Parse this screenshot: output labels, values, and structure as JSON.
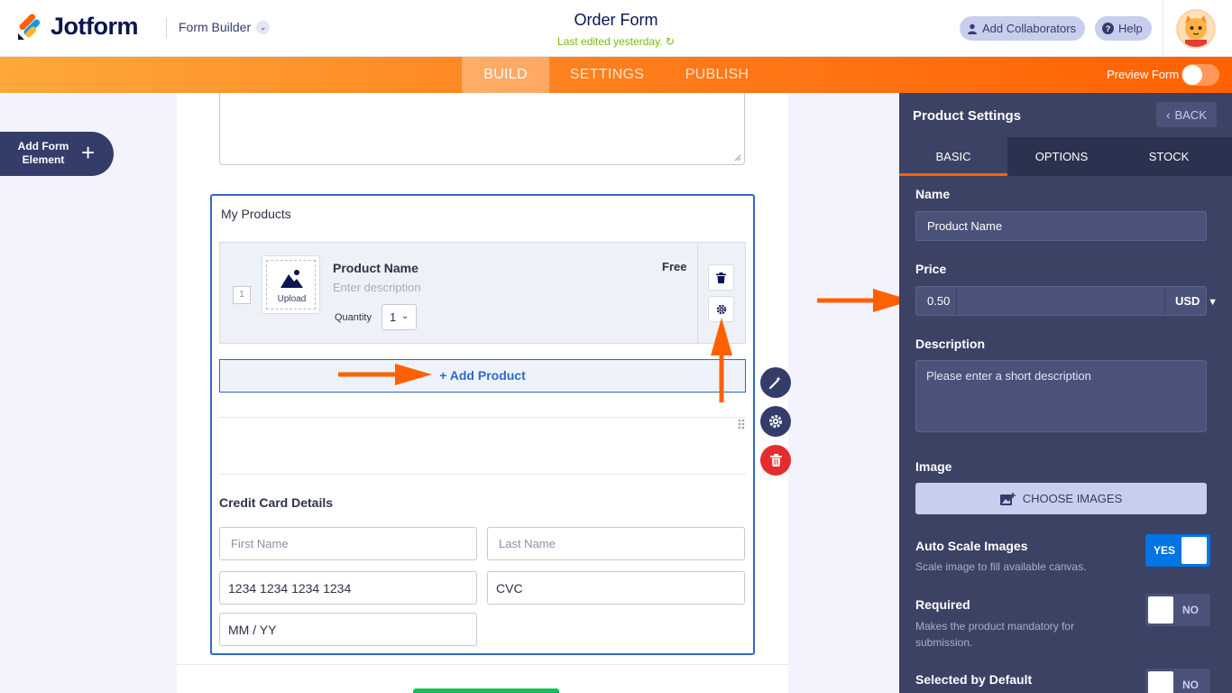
{
  "header": {
    "brand": "Jotform",
    "builder_label": "Form Builder",
    "form_title": "Order Form",
    "last_edited": "Last edited yesterday.",
    "collab_label": "Add Collaborators",
    "help_label": "Help"
  },
  "nav": {
    "tabs": [
      {
        "label": "BUILD"
      },
      {
        "label": "SETTINGS"
      },
      {
        "label": "PUBLISH"
      }
    ],
    "preview_label": "Preview Form"
  },
  "sidebar": {
    "add_element_label": "Add Form Element"
  },
  "form": {
    "products_label": "My Products",
    "product": {
      "number": "1",
      "upload_label": "Upload",
      "name": "Product Name",
      "description_placeholder": "Enter description",
      "quantity_label": "Quantity",
      "quantity_value": "1",
      "price_label": "Free"
    },
    "add_product_label": "+ Add Product",
    "cc_title": "Credit Card Details",
    "cc_fields": {
      "first_name": "First Name",
      "last_name": "Last Name",
      "card_number": "1234 1234 1234 1234",
      "cvc": "CVC",
      "expiry": "MM / YY"
    }
  },
  "panel": {
    "title": "Product Settings",
    "back_label": "BACK",
    "tabs": [
      {
        "label": "BASIC"
      },
      {
        "label": "OPTIONS"
      },
      {
        "label": "STOCK"
      }
    ],
    "name_label": "Name",
    "name_value": "Product Name",
    "price_label": "Price",
    "price_value": "0.50",
    "currency": "USD",
    "description_label": "Description",
    "description_placeholder": "Please enter a short description",
    "image_label": "Image",
    "choose_images_label": "CHOOSE IMAGES",
    "auto_scale": {
      "label": "Auto Scale Images",
      "sub": "Scale image to fill available canvas.",
      "state": "YES"
    },
    "required": {
      "label": "Required",
      "sub": "Makes the product mandatory for submission.",
      "state": "NO"
    },
    "selected_default": {
      "label": "Selected by Default",
      "state": "NO"
    }
  },
  "colors": {
    "accent_orange": "#ff6100",
    "brand_navy": "#0a1551",
    "link_blue": "#2e69c9",
    "panel_bg": "#3b4264",
    "success_green": "#78bb07",
    "danger_red": "#e52d2d"
  }
}
